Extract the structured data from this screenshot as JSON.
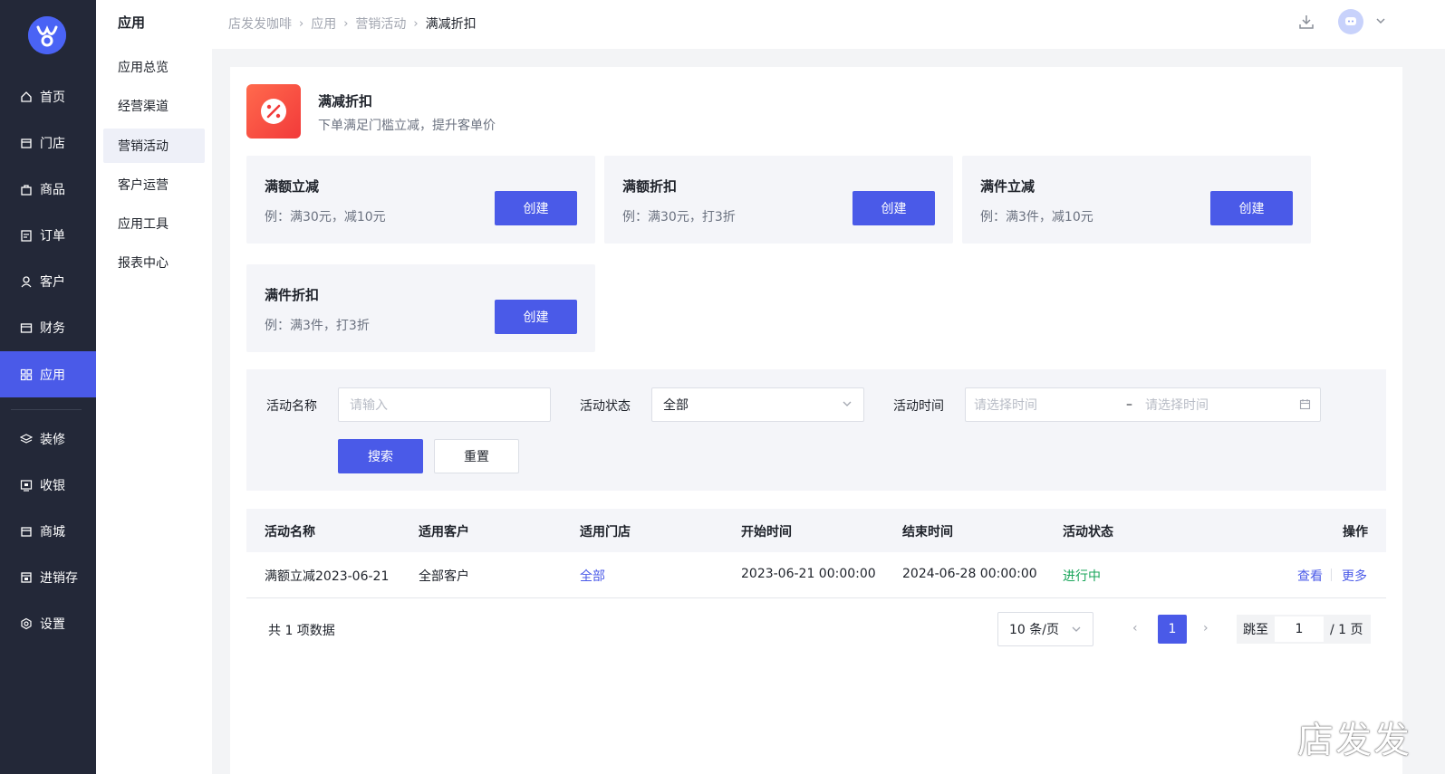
{
  "nav": {
    "items": [
      {
        "label": "首页",
        "icon": "home-icon"
      },
      {
        "label": "门店",
        "icon": "store-icon"
      },
      {
        "label": "商品",
        "icon": "bag-icon"
      },
      {
        "label": "订单",
        "icon": "order-icon"
      },
      {
        "label": "客户",
        "icon": "user-icon"
      },
      {
        "label": "财务",
        "icon": "wallet-icon"
      },
      {
        "label": "应用",
        "icon": "apps-icon",
        "active": true
      },
      {
        "label": "装修",
        "icon": "layers-icon"
      },
      {
        "label": "收银",
        "icon": "cashier-icon"
      },
      {
        "label": "商城",
        "icon": "shop-icon"
      },
      {
        "label": "进销存",
        "icon": "inventory-icon"
      },
      {
        "label": "设置",
        "icon": "settings-icon"
      }
    ]
  },
  "submenu": {
    "title": "应用",
    "items": [
      "应用总览",
      "经营渠道",
      "营销活动",
      "客户运营",
      "应用工具",
      "报表中心"
    ],
    "active": "营销活动"
  },
  "header": {
    "breadcrumb": [
      "店发发咖啡",
      "应用",
      "营销活动",
      "满减折扣"
    ]
  },
  "app": {
    "title": "满减折扣",
    "desc": "下单满足门槛立减，提升客单价"
  },
  "types": [
    {
      "title": "满额立减",
      "desc": "例：满30元，减10元",
      "button": "创建"
    },
    {
      "title": "满额折扣",
      "desc": "例：满30元，打3折",
      "button": "创建"
    },
    {
      "title": "满件立减",
      "desc": "例：满3件，减10元",
      "button": "创建"
    },
    {
      "title": "满件折扣",
      "desc": "例：满3件，打3折",
      "button": "创建"
    }
  ],
  "filter": {
    "name_label": "活动名称",
    "name_placeholder": "请输入",
    "status_label": "活动状态",
    "status_value": "全部",
    "time_label": "活动时间",
    "time_start_placeholder": "请选择时间",
    "time_sep": "–",
    "time_end_placeholder": "请选择时间",
    "search": "搜索",
    "reset": "重置"
  },
  "table": {
    "headers": [
      "活动名称",
      "适用客户",
      "适用门店",
      "开始时间",
      "结束时间",
      "活动状态",
      "操作"
    ],
    "rows": [
      {
        "name": "满额立减2023-06-21",
        "customer": "全部客户",
        "store": "全部",
        "start": "2023-06-21 00:00:00",
        "end": "2024-06-28 00:00:00",
        "status": "进行中",
        "view": "查看",
        "more": "更多"
      }
    ]
  },
  "pagination": {
    "total": "共 1 项数据",
    "page_size": "10 条/页",
    "current": "1",
    "jump_label": "跳至",
    "jump_value": "1",
    "pages": "/ 1 页"
  },
  "watermark": "店发发",
  "colors": {
    "primary": "#4a5ae8",
    "nav_bg": "#232838",
    "status_green": "#19a55a"
  }
}
